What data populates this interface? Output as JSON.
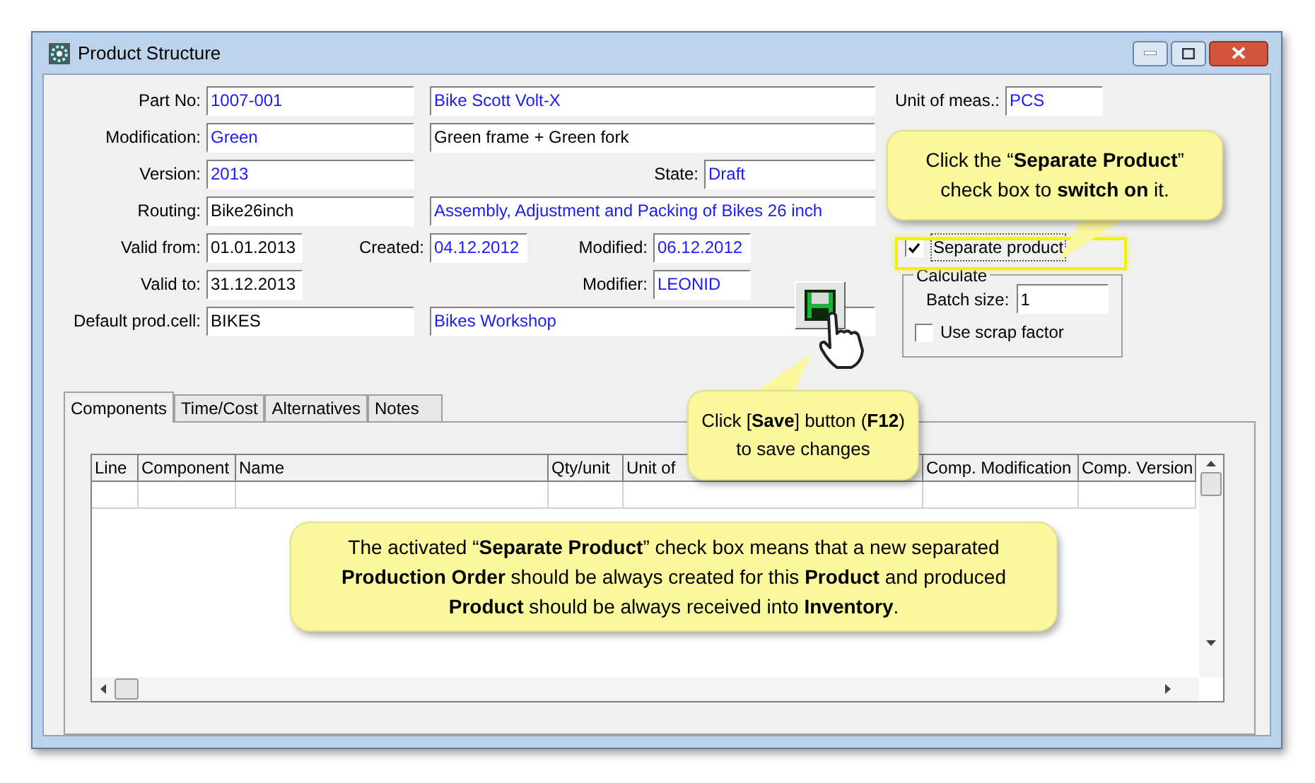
{
  "window": {
    "title": "Product Structure"
  },
  "form": {
    "part_no": {
      "label": "Part No:",
      "value": "1007-001",
      "linked": true
    },
    "part_name": {
      "value": "Bike Scott Volt-X",
      "linked": true
    },
    "modification": {
      "label": "Modification:",
      "value": "Green",
      "linked": true
    },
    "modification_name": {
      "value": "Green frame + Green fork",
      "linked": false
    },
    "version": {
      "label": "Version:",
      "value": "2013",
      "linked": true
    },
    "state": {
      "label": "State:",
      "value": "Draft",
      "linked": true
    },
    "routing": {
      "label": "Routing:",
      "value": "Bike26inch",
      "linked": false
    },
    "routing_name": {
      "value": "Assembly, Adjustment and Packing of Bikes 26 inch",
      "linked": true
    },
    "valid_from": {
      "label": "Valid from:",
      "value": "01.01.2013",
      "linked": false
    },
    "created": {
      "label": "Created:",
      "value": "04.12.2012",
      "linked": true
    },
    "modified": {
      "label": "Modified:",
      "value": "06.12.2012",
      "linked": true
    },
    "valid_to": {
      "label": "Valid to:",
      "value": "31.12.2013",
      "linked": false
    },
    "modifier": {
      "label": "Modifier:",
      "value": "LEONID",
      "linked": true
    },
    "default_prod_cell": {
      "label": "Default prod.cell:",
      "value": "BIKES",
      "linked": false
    },
    "prod_cell_name": {
      "value": "Bikes Workshop",
      "linked": true
    },
    "unit_of_meas": {
      "label": "Unit of meas.:",
      "value": "PCS",
      "linked": true
    },
    "separate_product": {
      "label": "Separate product",
      "checked": true
    },
    "calculate": {
      "title": "Calculate",
      "batch_size": {
        "label": "Batch size:",
        "value": "1"
      },
      "use_scrap_factor": {
        "label": "Use scrap factor",
        "checked": false
      }
    }
  },
  "tabs": [
    {
      "label": "Components",
      "selected": true
    },
    {
      "label": "Time/Cost",
      "selected": false
    },
    {
      "label": "Alternatives",
      "selected": false
    },
    {
      "label": "Notes",
      "selected": false
    }
  ],
  "table": {
    "columns": [
      "Line",
      "Component",
      "Name",
      "Qty/unit",
      "Unit of",
      "Comp. Modification",
      "Comp. Version"
    ]
  },
  "callouts": [
    {
      "text": "Click the “**Separate Product**” check box to **switch on** it."
    },
    {
      "text": "Click [**Save**] button (**F12**) to save changes"
    },
    {
      "text": "The activated “**Separate Product**” check box means that a new separated **Production Order** should be always created for this **Product** and produced **Product** should be always received into **Inventory**."
    }
  ]
}
